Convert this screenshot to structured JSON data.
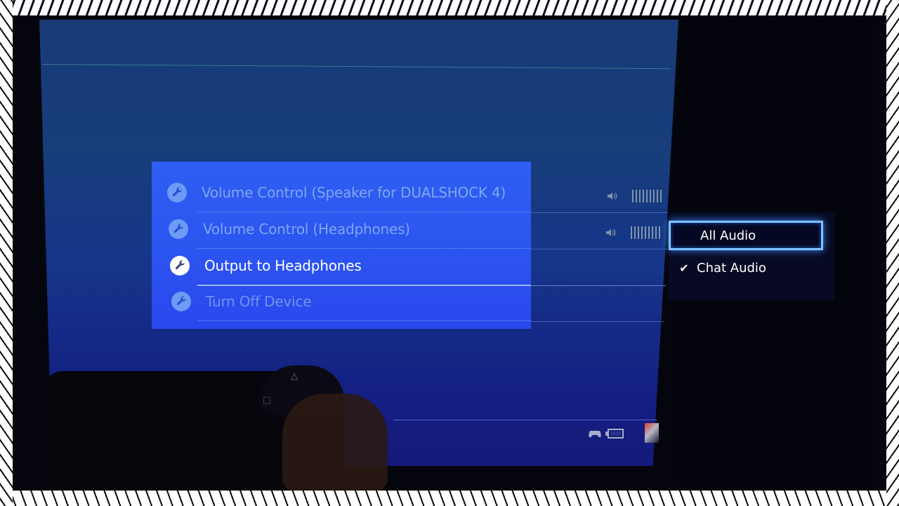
{
  "settings_menu": {
    "items": [
      {
        "label": "Volume Control (Speaker for DUALSHOCK 4)",
        "icon": "wrench-icon",
        "state": "inactive"
      },
      {
        "label": "Volume Control (Headphones)",
        "icon": "wrench-icon",
        "state": "inactive"
      },
      {
        "label": "Output to Headphones",
        "icon": "wrench-icon",
        "state": "focused"
      },
      {
        "label": "Turn Off Device",
        "icon": "wrench-icon",
        "state": "disabled"
      }
    ]
  },
  "volume_indicators": [
    {
      "for": "Volume Control (Speaker for DUALSHOCK 4)",
      "icon": "speaker-icon"
    },
    {
      "for": "Volume Control (Headphones)",
      "icon": "speaker-icon"
    }
  ],
  "output_popup": {
    "options": [
      {
        "label": "All Audio",
        "focused": true,
        "checked": false
      },
      {
        "label": "Chat Audio",
        "focused": false,
        "checked": true
      }
    ],
    "check_glyph": "✔"
  },
  "status_bar": {
    "icons": [
      "controller-icon",
      "battery-icon",
      "user-avatar"
    ]
  },
  "controller_buttons": {
    "triangle": "△",
    "square": "□"
  },
  "colors": {
    "overlay_blue": "#2f5ef2",
    "focus_glow": "#7fc0ff",
    "screen_blue": "#173d7a"
  }
}
